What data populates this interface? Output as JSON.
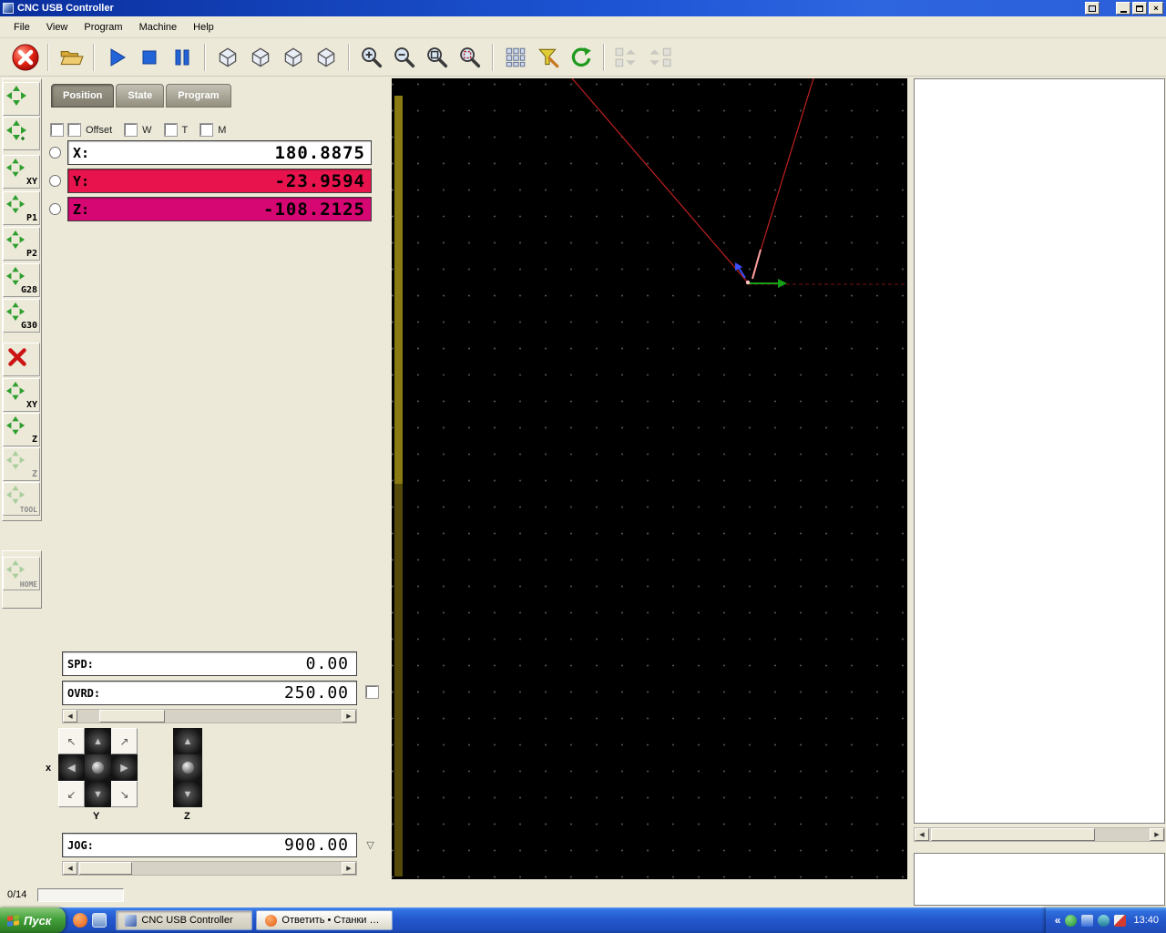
{
  "window": {
    "title": "CNC USB Controller"
  },
  "menu": {
    "items": [
      "File",
      "View",
      "Program",
      "Machine",
      "Help"
    ]
  },
  "glyphs": {
    "close": "×",
    "up": "▲",
    "down": "▼",
    "left": "◀",
    "right": "▶",
    "nw": "↖",
    "ne": "↗",
    "sw": "↙",
    "se": "↘",
    "drop": "▽"
  },
  "sidebar": {
    "items": [
      {
        "label": ""
      },
      {
        "label": ""
      },
      {
        "label": "XY"
      },
      {
        "label": "P1"
      },
      {
        "label": "P2"
      },
      {
        "label": "G28"
      },
      {
        "label": "G30"
      },
      {
        "label": ""
      },
      {
        "label": "XY"
      },
      {
        "label": "Z"
      },
      {
        "label": "Z"
      },
      {
        "label": "TOOL"
      },
      {
        "label": "HOME"
      }
    ]
  },
  "panel": {
    "tabs": [
      {
        "label": "Position"
      },
      {
        "label": "State"
      },
      {
        "label": "Program"
      }
    ],
    "checks": {
      "offset": "Offset",
      "w": "W",
      "t": "T",
      "m": "M"
    },
    "coordinates": [
      {
        "axis": "X:",
        "value": "180.8875",
        "style": "background:#ffffff"
      },
      {
        "axis": "Y:",
        "value": "-23.9594",
        "style": "background:#e8134d"
      },
      {
        "axis": "Z:",
        "value": "-108.2125",
        "style": "background:#d60672"
      }
    ],
    "spd": {
      "label": "SPD:",
      "value": "0.00"
    },
    "ovrd": {
      "label": "OVRD:",
      "value": "250.00"
    },
    "jog": {
      "label": "JOG:",
      "value": "900.00"
    },
    "axis_labels": {
      "x": "x",
      "y": "Y",
      "z": "Z"
    },
    "progress": "0/14"
  },
  "taskbar": {
    "start_label": "Пуск",
    "tasks": [
      {
        "label": "CNC USB Controller"
      },
      {
        "label": "Ответить • Станки с Ч..."
      }
    ],
    "tray_collapse": "«",
    "clock": "13:40"
  },
  "colors": {
    "y_row": "#e8134d",
    "z_row": "#d60672",
    "taskbar_blue": "#2458cd",
    "start_green": "#43a13a"
  }
}
